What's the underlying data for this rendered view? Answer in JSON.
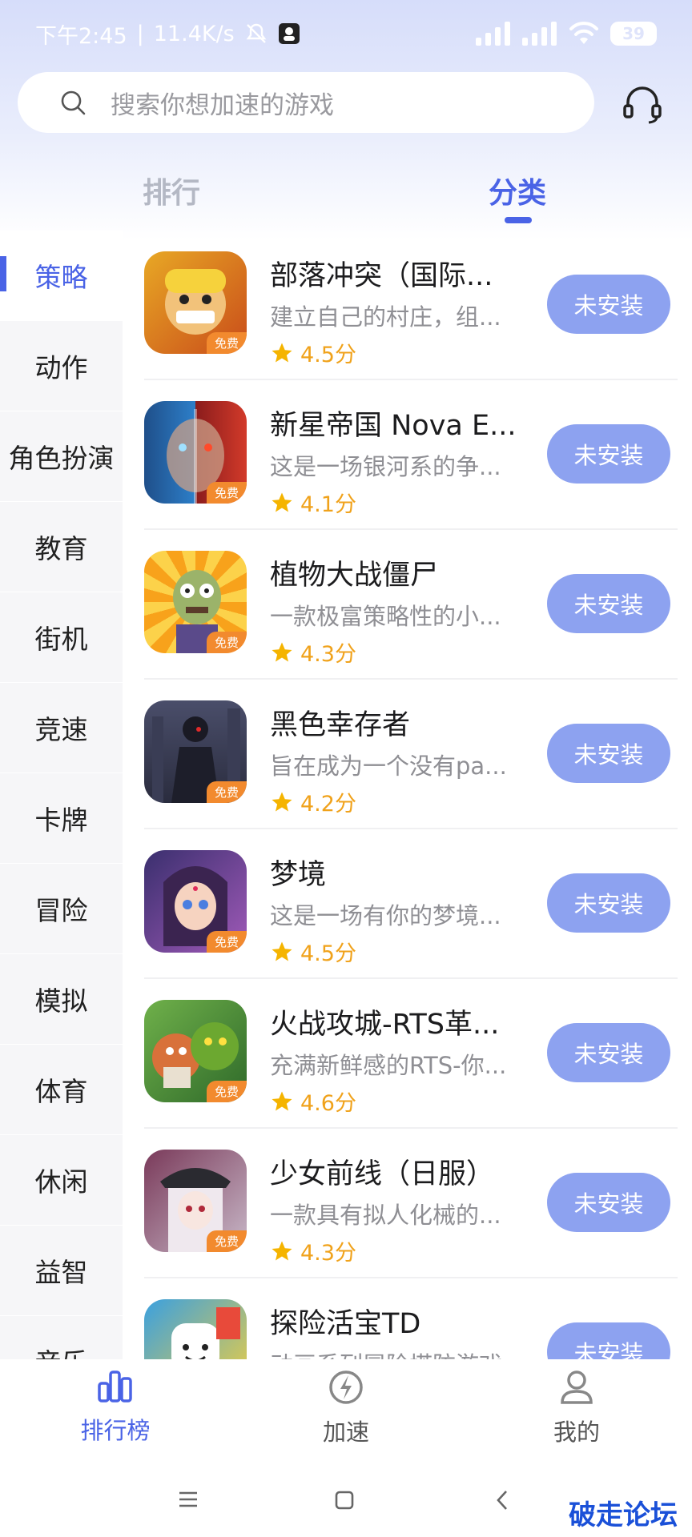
{
  "status_bar": {
    "time": "下午2:45",
    "speed": "11.4K/s",
    "battery": "39"
  },
  "search": {
    "placeholder": "搜索你想加速的游戏"
  },
  "tabs": [
    {
      "label": "排行",
      "active": false
    },
    {
      "label": "分类",
      "active": true
    }
  ],
  "categories": [
    {
      "label": "策略",
      "active": true
    },
    {
      "label": "动作"
    },
    {
      "label": "角色扮演"
    },
    {
      "label": "教育"
    },
    {
      "label": "街机"
    },
    {
      "label": "竞速"
    },
    {
      "label": "卡牌"
    },
    {
      "label": "冒险"
    },
    {
      "label": "模拟"
    },
    {
      "label": "体育"
    },
    {
      "label": "休闲"
    },
    {
      "label": "益智"
    },
    {
      "label": "音乐"
    }
  ],
  "free_tag": "免费",
  "games": [
    {
      "title": "部落冲突（国际...",
      "desc": "建立自己的村庄，组...",
      "rating": "4.5分",
      "button": "未安装"
    },
    {
      "title": "新星帝国 Nova E...",
      "desc": "这是一场银河系的争...",
      "rating": "4.1分",
      "button": "未安装"
    },
    {
      "title": "植物大战僵尸",
      "desc": "一款极富策略性的小...",
      "rating": "4.3分",
      "button": "未安装"
    },
    {
      "title": "黑色幸存者",
      "desc": "旨在成为一个没有pa...",
      "rating": "4.2分",
      "button": "未安装"
    },
    {
      "title": "梦境",
      "desc": "这是一场有你的梦境...",
      "rating": "4.5分",
      "button": "未安装"
    },
    {
      "title": "火战攻城-RTS革...",
      "desc": "充满新鲜感的RTS-你...",
      "rating": "4.6分",
      "button": "未安装"
    },
    {
      "title": "少女前线（日服）",
      "desc": "一款具有拟人化械的...",
      "rating": "4.3分",
      "button": "未安装"
    },
    {
      "title": "探险活宝TD",
      "desc": "动画系列冒险塔防游戏",
      "rating": "",
      "button": "未安装"
    }
  ],
  "bottom_nav": [
    {
      "label": "排行榜",
      "active": true
    },
    {
      "label": "加速",
      "active": false
    },
    {
      "label": "我的",
      "active": false
    }
  ],
  "watermark": "破走论坛",
  "colors": {
    "accent": "#4a63e6",
    "button": "#8da2f0",
    "star": "#f5b400"
  }
}
